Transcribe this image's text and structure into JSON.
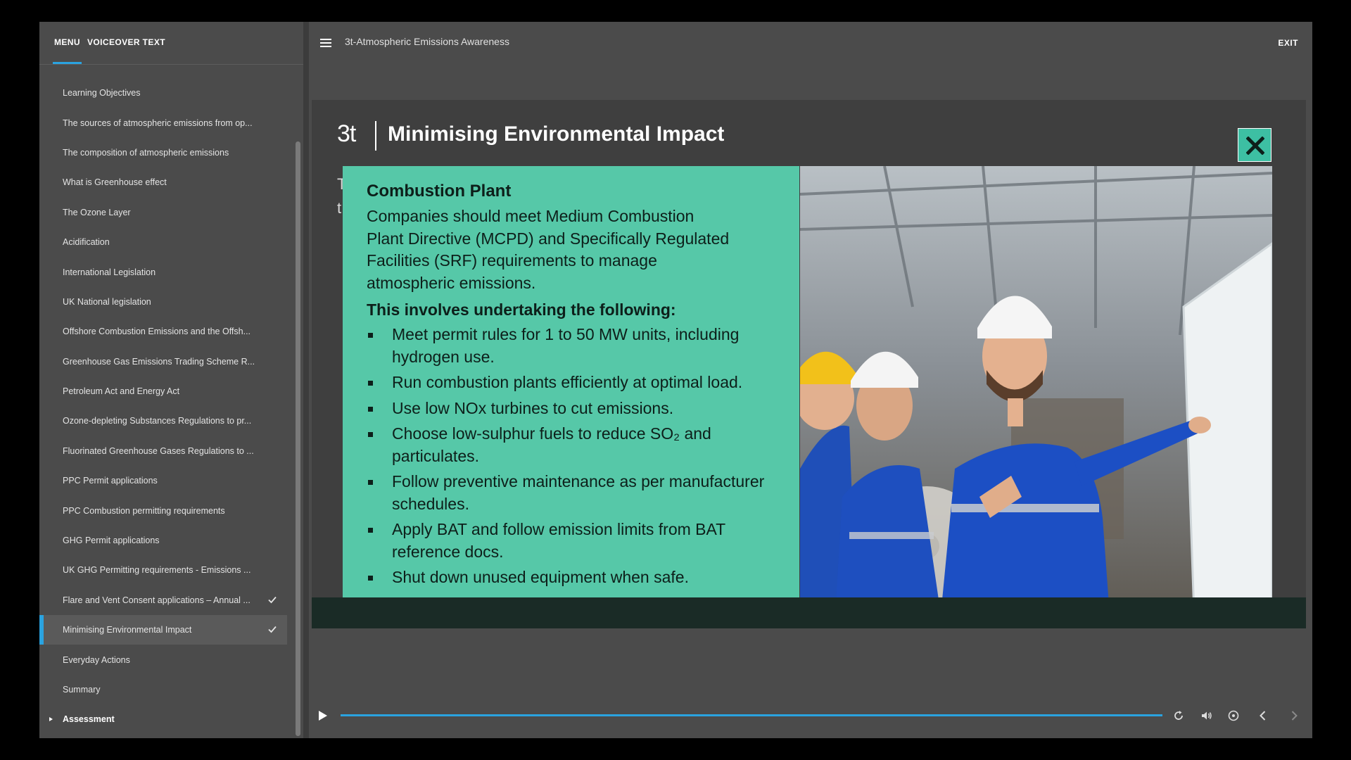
{
  "sidebar": {
    "tabs": {
      "menu": "MENU",
      "voiceover": "VOICEOVER TEXT"
    },
    "items": [
      {
        "label": "Learning Objectives"
      },
      {
        "label": "The sources of atmospheric emissions from op..."
      },
      {
        "label": "The composition of atmospheric emissions"
      },
      {
        "label": "What is Greenhouse effect"
      },
      {
        "label": "The Ozone Layer"
      },
      {
        "label": "Acidification"
      },
      {
        "label": "International Legislation"
      },
      {
        "label": "UK National legislation"
      },
      {
        "label": "Offshore Combustion Emissions and the Offsh..."
      },
      {
        "label": "Greenhouse Gas Emissions Trading Scheme R..."
      },
      {
        "label": "Petroleum Act and Energy Act"
      },
      {
        "label": "Ozone-depleting Substances Regulations to pr..."
      },
      {
        "label": "Fluorinated Greenhouse Gases Regulations to ..."
      },
      {
        "label": "PPC Permit applications"
      },
      {
        "label": "PPC Combustion permitting requirements"
      },
      {
        "label": "GHG Permit applications"
      },
      {
        "label": "UK GHG Permitting requirements - Emissions ..."
      },
      {
        "label": "Flare and Vent Consent applications – Annual ...",
        "completed": true
      },
      {
        "label": "Minimising Environmental Impact",
        "completed": true,
        "active": true
      },
      {
        "label": "Everyday Actions"
      },
      {
        "label": "Summary"
      },
      {
        "label": "Assessment",
        "expandable": true
      }
    ]
  },
  "header": {
    "course_title": "3t-Atmospheric Emissions Awareness",
    "exit_label": "EXIT",
    "menu_icon": "hamburger-icon"
  },
  "slide": {
    "logo": "3t",
    "title": "Minimising Environmental Impact",
    "bg_text_fragments": [
      "T",
      "t"
    ],
    "popup": {
      "heading": "Combustion Plant",
      "intro": "Companies should meet Medium Combustion Plant Directive (MCPD) and Specifically Regulated Facilities (SRF) requirements to manage atmospheric emissions.",
      "subheading": "This involves undertaking the following:",
      "bullets": [
        "Meet permit rules for 1 to 50 MW units, including hydrogen use.",
        "Run combustion plants efficiently at optimal load.",
        "Use low NOx turbines to cut emissions.",
        "Choose low-sulphur fuels to reduce SO₂ and particulates.",
        "Follow preventive maintenance as per manufacturer schedules.",
        "Apply BAT and follow emission limits from BAT reference docs.",
        "Shut down unused equipment when safe."
      ],
      "image_icon": "engineers-at-whiteboard-photo"
    },
    "close_icon": "close-icon"
  },
  "player": {
    "progress": 1.0,
    "icons": [
      "play-icon",
      "replay-icon",
      "volume-icon",
      "captions-icon",
      "previous-icon",
      "next-icon"
    ]
  },
  "colors": {
    "accent": "#2aa3e0",
    "teal": "#56c8a8",
    "panel": "#4b4b4b",
    "footer": "#1a2b26"
  }
}
